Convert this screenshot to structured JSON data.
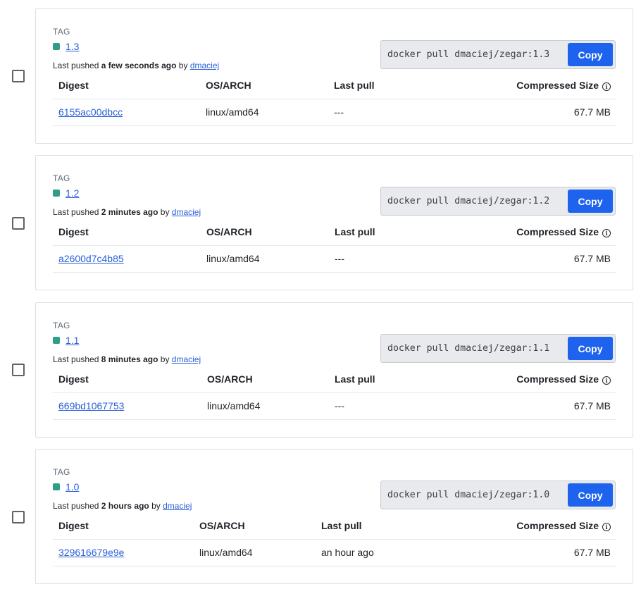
{
  "table_headers": {
    "digest": "Digest",
    "os_arch": "OS/ARCH",
    "last_pull": "Last pull",
    "size": "Compressed Size"
  },
  "tag_label": "TAG",
  "last_pushed_prefix": "Last pushed",
  "by_word": "by",
  "copy_label": "Copy",
  "info_icon_glyph": "i",
  "tag_dot_color": "#2f9e86",
  "accent_color": "#1d63ed",
  "rows": [
    {
      "tag": "1.3",
      "pushed_when": "a few seconds ago",
      "user": "dmaciej",
      "command": "docker pull dmaciej/zegar:1.3",
      "digest": "6155ac00dbcc",
      "os_arch": "linux/amd64",
      "last_pull": "---",
      "size": "67.7 MB"
    },
    {
      "tag": "1.2",
      "pushed_when": "2 minutes ago",
      "user": "dmaciej",
      "command": "docker pull dmaciej/zegar:1.2",
      "digest": "a2600d7c4b85",
      "os_arch": "linux/amd64",
      "last_pull": "---",
      "size": "67.7 MB"
    },
    {
      "tag": "1.1",
      "pushed_when": "8 minutes ago",
      "user": "dmaciej",
      "command": "docker pull dmaciej/zegar:1.1",
      "digest": "669bd1067753",
      "os_arch": "linux/amd64",
      "last_pull": "---",
      "size": "67.7 MB"
    },
    {
      "tag": "1.0",
      "pushed_when": "2 hours ago",
      "user": "dmaciej",
      "command": "docker pull dmaciej/zegar:1.0",
      "digest": "329616679e9e",
      "os_arch": "linux/amd64",
      "last_pull": "an hour ago",
      "size": "67.7 MB"
    }
  ]
}
